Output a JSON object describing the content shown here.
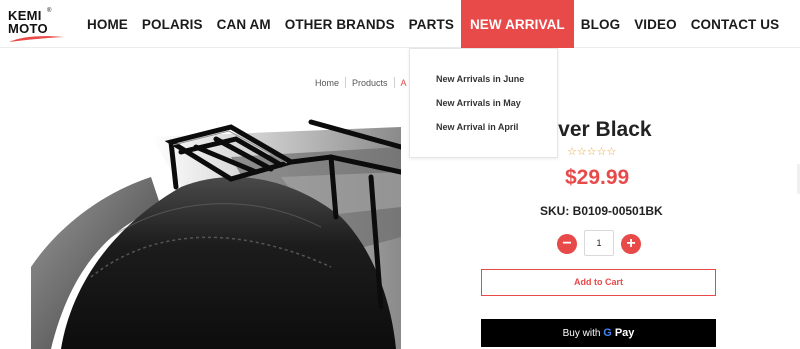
{
  "brand": {
    "logo_line1": "KEMI",
    "logo_line2": "MOTO",
    "registered": "®"
  },
  "nav": {
    "items": [
      {
        "label": "HOME"
      },
      {
        "label": "POLARIS"
      },
      {
        "label": "CAN AM"
      },
      {
        "label": "OTHER BRANDS"
      },
      {
        "label": "PARTS"
      },
      {
        "label": "NEW ARRIVAL",
        "active": true
      },
      {
        "label": "BLOG"
      },
      {
        "label": "VIDEO"
      },
      {
        "label": "CONTACT US"
      }
    ]
  },
  "dropdown": {
    "items": [
      {
        "label": "New Arrivals in June"
      },
      {
        "label": "New Arrivals in May"
      },
      {
        "label": "New Arrival in April"
      }
    ]
  },
  "breadcrumb": {
    "items": [
      "Home",
      "Products",
      "A"
    ]
  },
  "product": {
    "title": "Seat Cover Black",
    "rating_stars": "☆☆☆☆☆",
    "rating_value": 0,
    "price": "$29.99",
    "sku": "SKU: B0109-00501BK",
    "quantity": "1",
    "minus_symbol": "−",
    "plus_symbol": "+",
    "add_to_cart": "Add to Cart",
    "gpay_prefix": "Buy with",
    "gpay_g": "G",
    "gpay_pay": "Pay"
  },
  "colors": {
    "accent": "#e84a4a",
    "star": "#e8a33b",
    "text": "#222222"
  }
}
